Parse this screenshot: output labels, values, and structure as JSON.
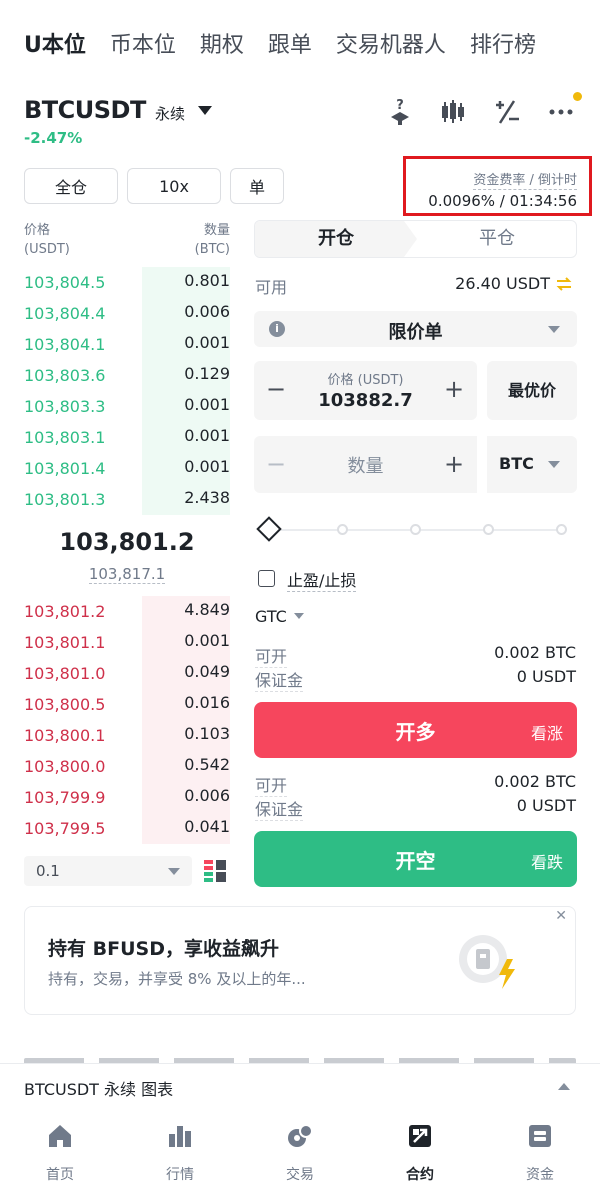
{
  "top_tabs": [
    "U本位",
    "币本位",
    "期权",
    "跟单",
    "交易机器人",
    "排行榜"
  ],
  "header": {
    "symbol": "BTCUSDT",
    "contract_type": "永续",
    "change_pct": "-2.47%",
    "icons": [
      "faq-icon",
      "candlestick-icon",
      "calculator-icon",
      "more-icon"
    ]
  },
  "margin": {
    "mode": "全仓",
    "leverage": "10x",
    "position_mode": "单"
  },
  "funding": {
    "label": "资金费率 / 倒计时",
    "value": "0.0096% / 01:34:56"
  },
  "order_book": {
    "price_header": "价格",
    "price_unit": "(USDT)",
    "qty_header": "数量",
    "qty_unit": "(BTC)",
    "asks": [
      {
        "price": "103,804.5",
        "qty": "0.801"
      },
      {
        "price": "103,804.4",
        "qty": "0.006"
      },
      {
        "price": "103,804.1",
        "qty": "0.001"
      },
      {
        "price": "103,803.6",
        "qty": "0.129"
      },
      {
        "price": "103,803.3",
        "qty": "0.001"
      },
      {
        "price": "103,803.1",
        "qty": "0.001"
      },
      {
        "price": "103,801.4",
        "qty": "0.001"
      },
      {
        "price": "103,801.3",
        "qty": "2.438"
      }
    ],
    "last_price": "103,801.2",
    "mark_price": "103,817.1",
    "bids": [
      {
        "price": "103,801.2",
        "qty": "4.849"
      },
      {
        "price": "103,801.1",
        "qty": "0.001"
      },
      {
        "price": "103,801.0",
        "qty": "0.049"
      },
      {
        "price": "103,800.5",
        "qty": "0.016"
      },
      {
        "price": "103,800.1",
        "qty": "0.103"
      },
      {
        "price": "103,800.0",
        "qty": "0.542"
      },
      {
        "price": "103,799.9",
        "qty": "0.006"
      },
      {
        "price": "103,799.5",
        "qty": "0.041"
      }
    ],
    "tick_size": "0.1"
  },
  "order_form": {
    "open_tab": "开仓",
    "close_tab": "平仓",
    "available_label": "可用",
    "available_value": "26.40 USDT",
    "order_type": "限价单",
    "price_label": "价格 (USDT)",
    "price_value": "103882.7",
    "best_price": "最优价",
    "quantity_placeholder": "数量",
    "quantity_unit": "BTC",
    "tpsl_label": "止盈/止损",
    "time_in_force": "GTC",
    "long": {
      "can_open_label": "可开",
      "can_open_value": "0.002 BTC",
      "margin_label": "保证金",
      "margin_value": "0 USDT",
      "button": "开多",
      "sub": "看涨"
    },
    "short": {
      "can_open_label": "可开",
      "can_open_value": "0.002 BTC",
      "margin_label": "保证金",
      "margin_value": "0 USDT",
      "button": "开空",
      "sub": "看跌"
    }
  },
  "promo": {
    "title": "持有 BFUSD，享收益飙升",
    "desc": "持有，交易，并享受 8% 及以上的年..."
  },
  "chart_bar": {
    "label": "BTCUSDT 永续  图表"
  },
  "bottom_nav": [
    {
      "label": "首页",
      "icon": "home-icon"
    },
    {
      "label": "行情",
      "icon": "markets-icon"
    },
    {
      "label": "交易",
      "icon": "trade-icon"
    },
    {
      "label": "合约",
      "icon": "futures-icon",
      "active": true
    },
    {
      "label": "资金",
      "icon": "wallet-icon"
    }
  ],
  "colors": {
    "green": "#2ebd85",
    "red": "#f6465d",
    "ask_depth": "#eefaf4",
    "bid_depth": "#fdf0f2",
    "accent": "#f0b90b",
    "highlight_box": "#e0191f"
  }
}
